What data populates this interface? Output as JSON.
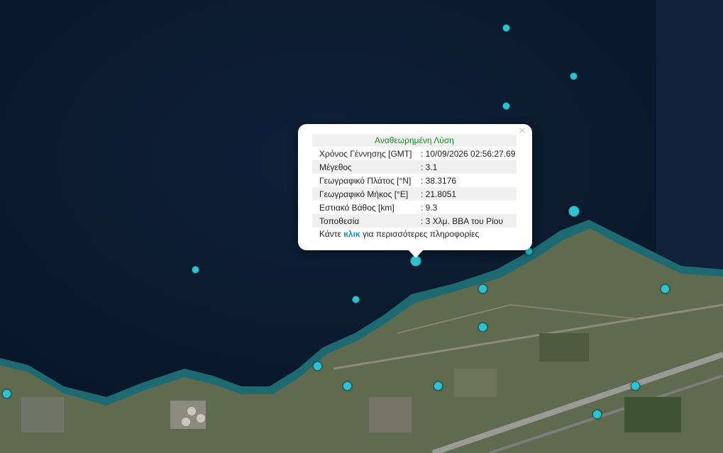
{
  "popup": {
    "title": "Αναθεωρημένη Λύση",
    "close_symbol": "×",
    "rows": [
      {
        "label": "Χρόνος Γέννησης [GMT]",
        "value": ": 10/09/2026 02:56:27.69"
      },
      {
        "label": "Μέγεθος",
        "value": ": 3.1"
      },
      {
        "label": "Γεωγραφικό Πλάτος [°N]",
        "value": ": 38.3176"
      },
      {
        "label": "Γεωγραφικό Μήκος [°E]",
        "value": ": 21.8051"
      },
      {
        "label": "Εστιακό Βάθος [km]",
        "value": ": 9.3"
      },
      {
        "label": "Τοποθεσία",
        "value": ": 3 Χλμ. ΒΒΑ του Ρίου"
      }
    ],
    "more_prefix": "Κάντε ",
    "more_link": "κλικ",
    "more_suffix": " για περισσότερες πληροφορίες"
  },
  "colors": {
    "marker": "#2ec3d1",
    "heading_text": "#1a8a23",
    "link": "#1693b8",
    "sea": "#0c1b30",
    "land": "#5f6b4f"
  },
  "icons": {
    "close": "close-icon",
    "marker": "earthquake-marker"
  }
}
